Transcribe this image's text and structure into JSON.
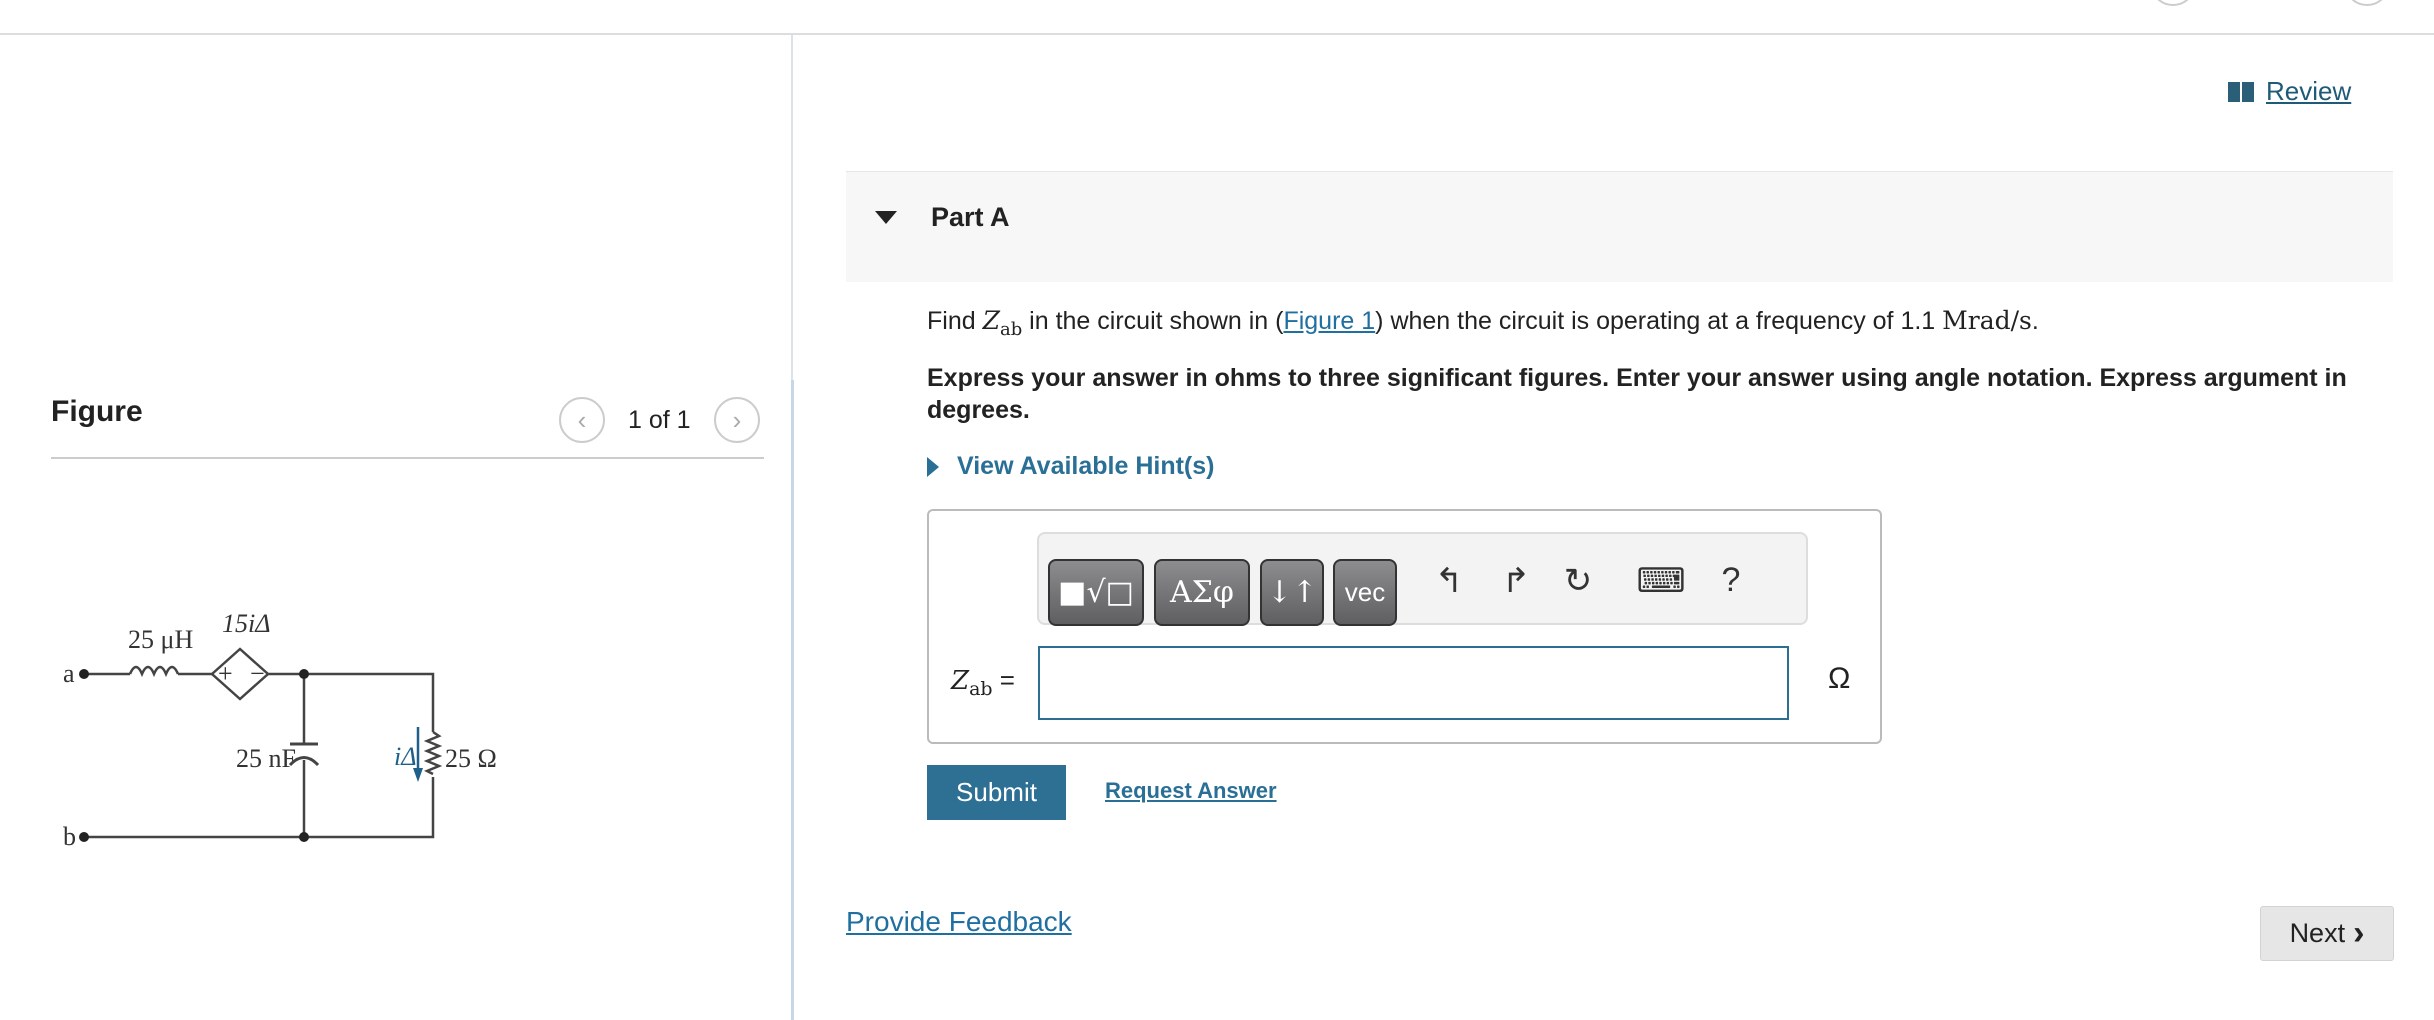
{
  "header": {
    "review_label": "Review",
    "review_icon": "book-icon"
  },
  "figure": {
    "label": "Figure",
    "counter": "1 of 1",
    "prev_icon": "chevron-left-icon",
    "next_icon": "chevron-right-icon",
    "circuit": {
      "terminal_a": "a",
      "terminal_b": "b",
      "inductor": "25 μH",
      "source": "15iΔ",
      "source_plus": "+",
      "source_minus": "−",
      "capacitor": "25 nF",
      "current": "iΔ",
      "resistor": "25 Ω",
      "current_arrow_color": "#1f5f8b"
    }
  },
  "part": {
    "title": "Part A",
    "question": {
      "pre": "Find ",
      "var": "Z",
      "sub": "ab",
      "mid": " in the circuit shown in (",
      "link": "Figure 1",
      "post": ") when the circuit is operating at a frequency of 1.1 ",
      "unit": "Mrad/s",
      "end": "."
    },
    "instructions": "Express your answer in ohms to three significant figures. Enter your answer using angle notation. Express argument in degrees.",
    "hint_label": "View Available Hint(s)",
    "toolbar": {
      "templates": "■√□",
      "greek": "ΑΣφ",
      "arrows": "↓↑",
      "vec": "vec",
      "undo": "↰",
      "redo": "↱",
      "reset": "↻",
      "keyboard": "⌨",
      "help": "?"
    },
    "answer": {
      "label_var": "Z",
      "label_sub": "ab",
      "label_eq": " =",
      "value": "",
      "unit": "Ω"
    },
    "submit_label": "Submit",
    "request_answer_label": "Request Answer"
  },
  "footer": {
    "feedback_label": "Provide Feedback",
    "next_label": "Next",
    "next_icon": "›"
  }
}
